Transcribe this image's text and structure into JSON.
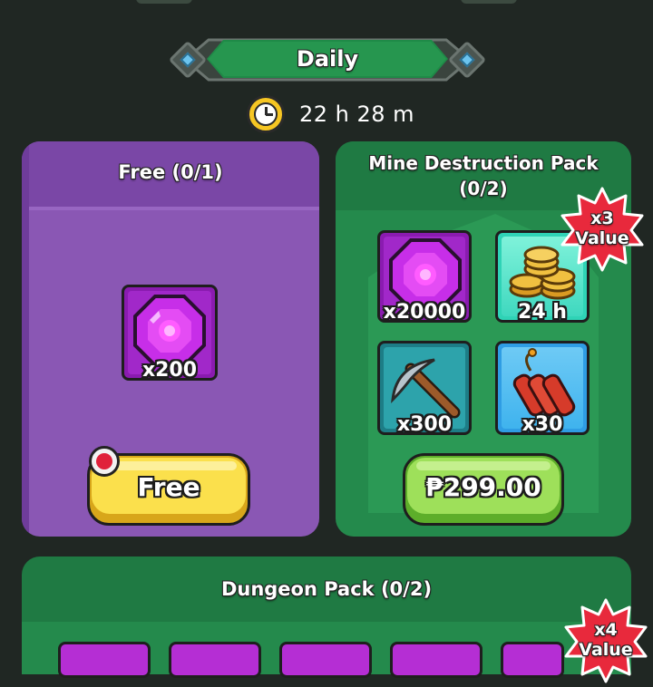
{
  "section": {
    "title": "Daily",
    "timer": "22 h 28 m"
  },
  "free_card": {
    "title": "Free (0/1)",
    "item_qty": "x200",
    "button_label": "Free"
  },
  "mine_card": {
    "title_line1": "Mine Destruction Pack",
    "title_line2": "(0/2)",
    "badge_line1": "x3",
    "badge_line2": "Value",
    "items": [
      {
        "icon": "gem-icon",
        "qty": "x20000"
      },
      {
        "icon": "coins-icon",
        "qty": "24 h"
      },
      {
        "icon": "pickaxe-icon",
        "qty": "x300"
      },
      {
        "icon": "dynamite-icon",
        "qty": "x30"
      }
    ],
    "price": "₱299.00"
  },
  "dungeon_card": {
    "title": "Dungeon Pack (0/2)",
    "badge_line1": "x4",
    "badge_line2": "Value"
  },
  "colors": {
    "background": "#202723",
    "green_card": "#248a4c",
    "purple_card": "#8a57b4",
    "free_button": "#fbe04c",
    "price_button": "#9ee05a",
    "value_badge": "#e8293c"
  }
}
